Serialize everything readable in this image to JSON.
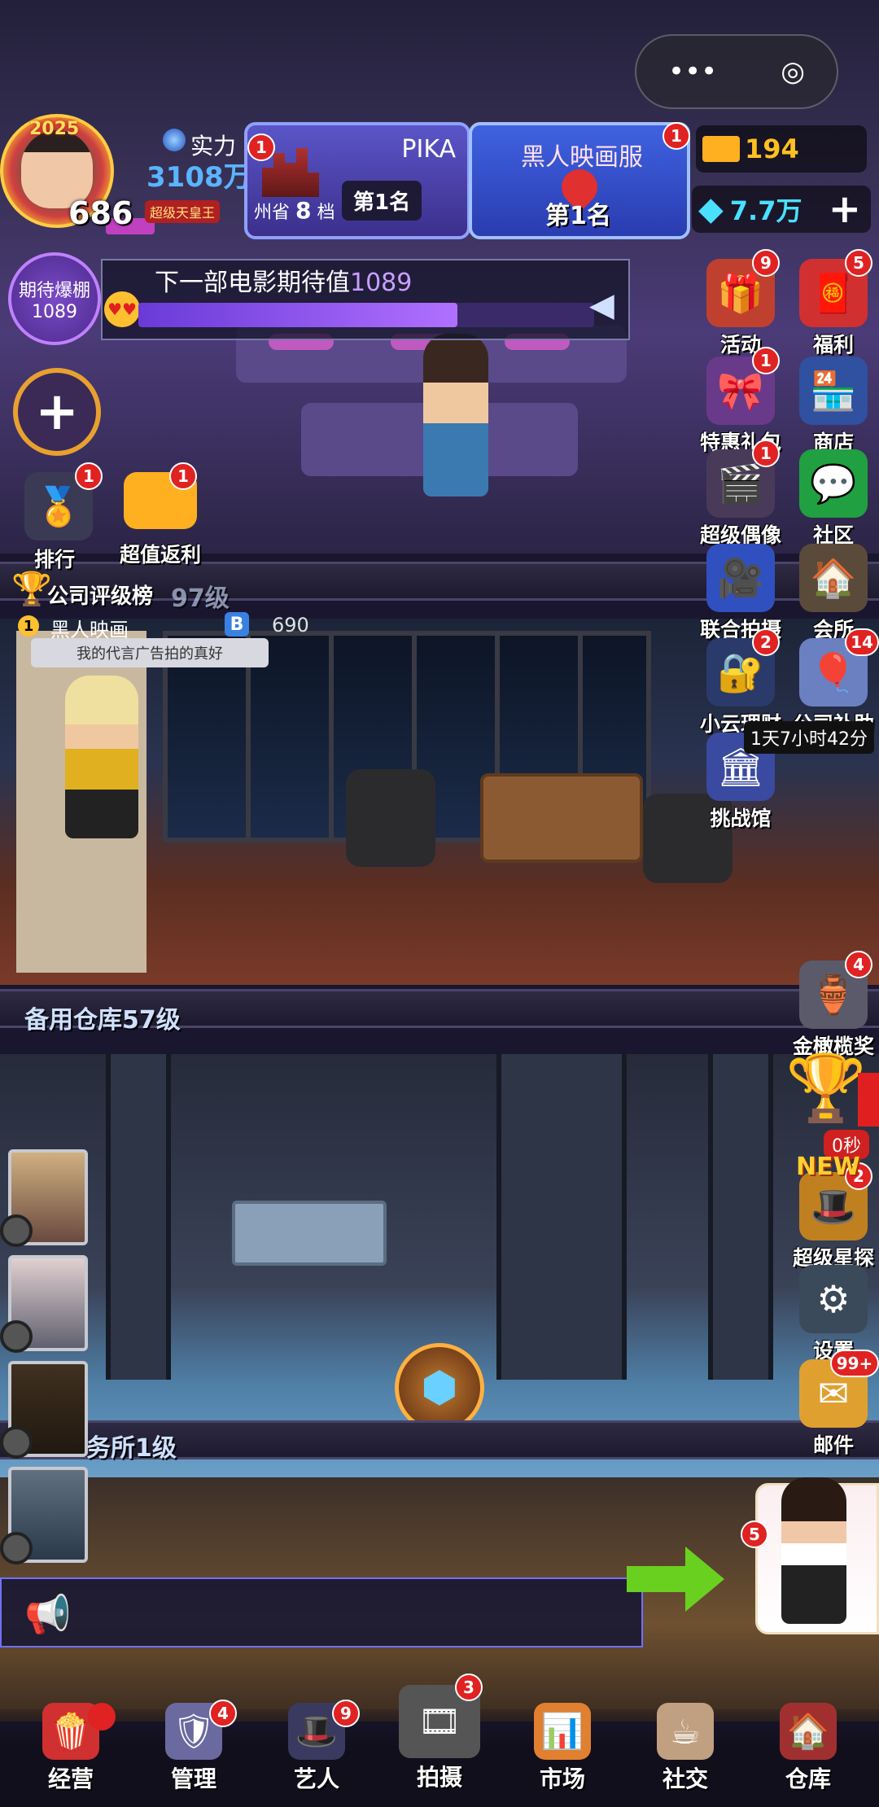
{
  "hud": {
    "year": "2025",
    "level": "686",
    "title_badge": "超级天皇王",
    "power_label": "实力",
    "power_value": "3108万",
    "card_left": {
      "name": "PIKA",
      "region": "州省",
      "tier": "8",
      "tier_unit": "档",
      "rank": "第1名",
      "badge": "1"
    },
    "card_right": {
      "name": "黑人映画服",
      "rank": "第1名",
      "badge": "1"
    },
    "gold": "194",
    "diamonds": "7.7万",
    "add_symbol": "+",
    "capsule_more": "•••",
    "capsule_close": "◎"
  },
  "expectation": {
    "circle_title": "期待爆棚",
    "circle_value": "1089",
    "bar_text": "下一部电影期待值",
    "bar_value": "1089",
    "progress": 0.7
  },
  "left_buttons": {
    "plus": "+",
    "rank": {
      "label": "排行",
      "badge": "1"
    },
    "rebate": {
      "label": "超值返利",
      "badge": "1"
    }
  },
  "right_icons": [
    {
      "id": "activity",
      "label": "活动",
      "badge": "9"
    },
    {
      "id": "welfare",
      "label": "福利",
      "badge": "5"
    },
    {
      "id": "special-pack",
      "label": "特惠礼包",
      "badge": "1"
    },
    {
      "id": "shop",
      "label": "商店",
      "badge": ""
    },
    {
      "id": "super-idol",
      "label": "超级偶像",
      "badge": "1"
    },
    {
      "id": "community",
      "label": "社区",
      "badge": ""
    },
    {
      "id": "joint-shoot",
      "label": "联合拍摄",
      "badge": ""
    },
    {
      "id": "club",
      "label": "会所",
      "badge": ""
    },
    {
      "id": "yun-finance",
      "label": "小云理财",
      "badge": "2"
    },
    {
      "id": "company-aid",
      "label": "公司补助",
      "badge": "14"
    },
    {
      "id": "challenge",
      "label": "挑战馆",
      "badge": ""
    },
    {
      "id": "golden-olive",
      "label": "金橄榄奖",
      "badge": "4"
    },
    {
      "id": "super-scout",
      "label": "超级星探",
      "badge": "2"
    },
    {
      "id": "settings",
      "label": "设置",
      "badge": ""
    },
    {
      "id": "mail",
      "label": "邮件",
      "badge": "99+"
    }
  ],
  "company_aid_timer": "1天7小时42分",
  "trophy_timer": "0秒",
  "new_tag": "NEW",
  "company_rank": {
    "title": "公司评级榜",
    "floor_partial": "97级",
    "rank": "1",
    "name": "黑人映画",
    "score": "690",
    "speech": "我的代言广告拍的真好"
  },
  "floors": {
    "warehouse": "备用仓库57级",
    "agency": "务所1级"
  },
  "assistant_badge": "5",
  "bottom_nav": [
    {
      "label": "经营",
      "badge": "",
      "icon": "popcorn-icon"
    },
    {
      "label": "管理",
      "badge": "4",
      "icon": "manage-icon"
    },
    {
      "label": "艺人",
      "badge": "9",
      "icon": "artist-icon"
    },
    {
      "label": "拍摄",
      "badge": "3",
      "icon": "camera-icon"
    },
    {
      "label": "市场",
      "badge": "",
      "icon": "market-icon"
    },
    {
      "label": "社交",
      "badge": "",
      "icon": "social-icon"
    },
    {
      "label": "仓库",
      "badge": "",
      "icon": "warehouse-icon"
    }
  ],
  "colors": {
    "badge_red": "#e02222",
    "gold": "#ffc020",
    "diamond": "#4ae0ff",
    "power_blue": "#5ab4ff"
  }
}
